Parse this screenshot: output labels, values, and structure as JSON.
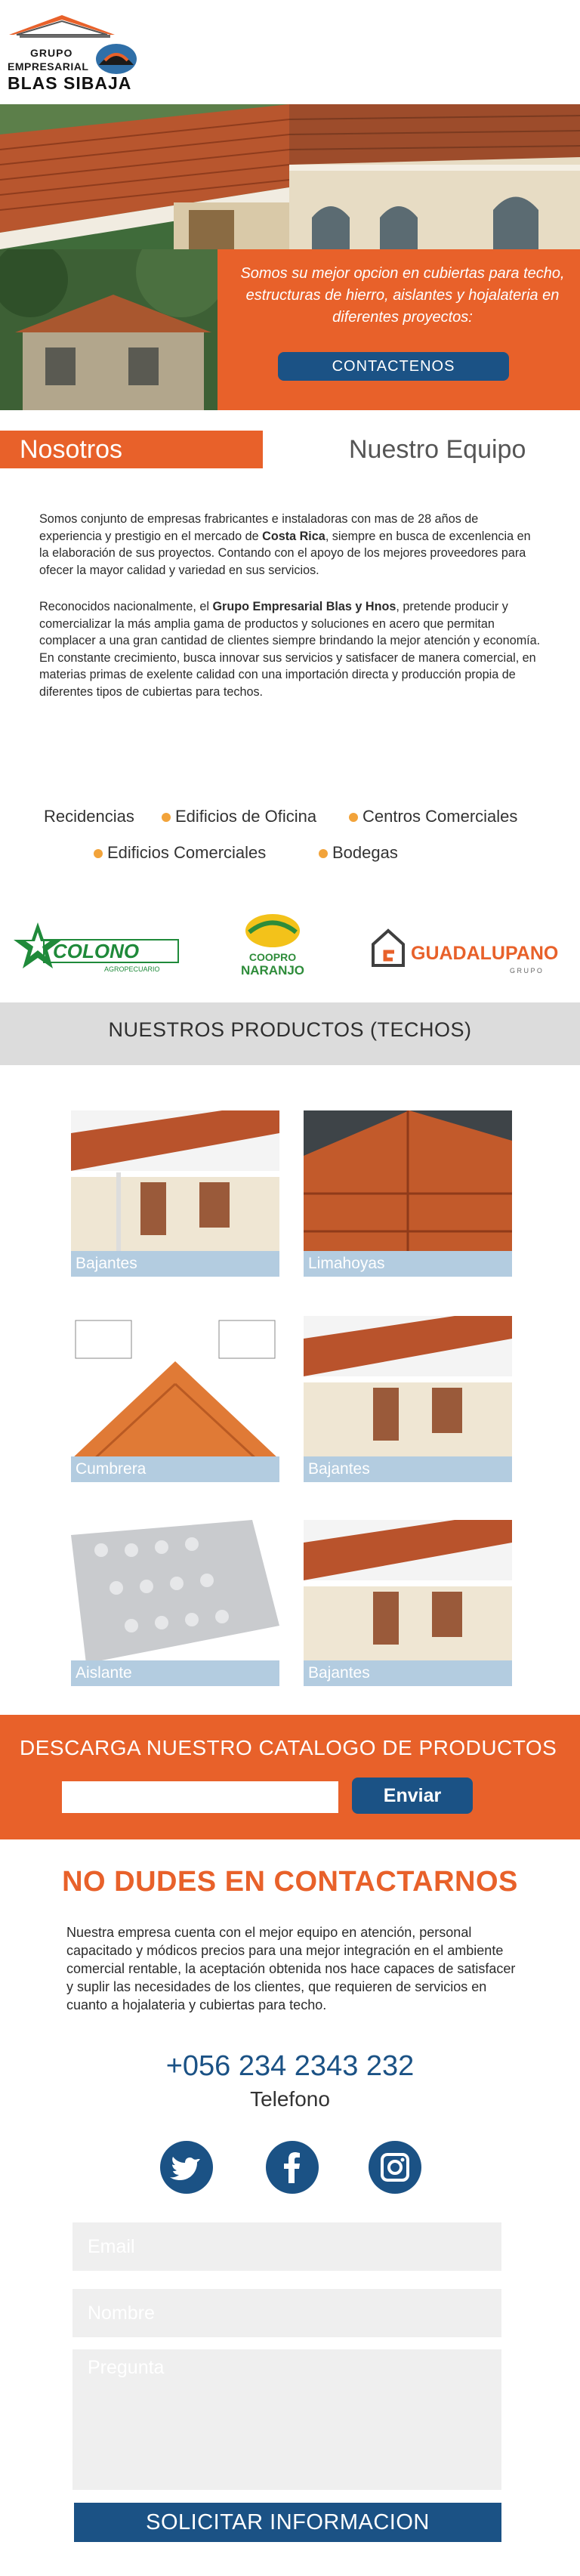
{
  "header": {
    "logo_line1": "GRUPO",
    "logo_line2": "EMPRESARIAL",
    "logo_line3": "BLAS SIBAJA"
  },
  "hero": {
    "text": "Somos su mejor opcion  en cubiertas para techo, estructuras de hierro, aislantes y hojalateria en diferentes proyectos:",
    "button": "CONTACTENOS"
  },
  "tabs": {
    "nosotros": "Nosotros",
    "equipo": "Nuestro Equipo"
  },
  "about": {
    "p1_a": "Somos conjunto de empresas frabricantes e instaladoras con mas de 28 años de experiencia  y prestigio en el mercado de ",
    "p1_b": "Costa Rica",
    "p1_c": ", siempre en busca de excenlencia en la elaboración de sus proyectos. Contando con el apoyo de los mejores proveedores para ofecer la mayor calidad y variedad en sus servicios.",
    "p2_a": "Reconocidos nacionalmente, el ",
    "p2_b": "Grupo Empresarial Blas y Hnos",
    "p2_c": ", pretende producir y comercializar la más amplia gama de productos y soluciones en acero que permitan complacer a una gran cantidad de clientes siempre brindando la mejor atención y economía. En constante crecimiento, busca innovar sus servicios y satisfacer de manera comercial, en materias primas de exelente calidad con una importación directa y producción propia de diferentes tipos de cubiertas para techos."
  },
  "categories": [
    "Recidencias",
    "Edificios de Oficina",
    "Centros Comerciales",
    "Edificios Comerciales",
    "Bodegas"
  ],
  "brands": {
    "colono": "COLONO",
    "colono_sub": "AGROPECUARIO",
    "coopro_1": "COOPRO",
    "coopro_2": "NARANJO",
    "guadalupano": "GUADALUPANO",
    "guadalupano_sub": "G R U P O"
  },
  "products": {
    "title": "NUESTROS PRODUCTOS (TECHOS)",
    "items": [
      "Bajantes",
      "Limahoyas",
      "Cumbrera",
      "Bajantes",
      "Aislante",
      "Bajantes"
    ]
  },
  "catalog": {
    "title": "DESCARGA NUESTRO CATALOGO DE PRODUCTOS",
    "button": "Enviar"
  },
  "contact": {
    "title": "NO DUDES EN CONTACTARNOS",
    "text": "Nuestra empresa cuenta con el mejor equipo en atención, personal capacitado y  módicos precios para una mejor integración en el ambiente comercial rentable, la aceptación obtenida nos hace capaces de satisfacer y suplir las necesidades de los clientes, que requieren de servicios en cuanto a hojalateria y cubiertas para techo.",
    "phone": "+056 234 2343 232",
    "phone_label": "Telefono",
    "email_placeholder": "Email",
    "name_placeholder": "Nombre",
    "question_placeholder": "Pregunta",
    "submit": "SOLICITAR INFORMACION"
  },
  "social": [
    "twitter-icon",
    "facebook-icon",
    "instagram-icon"
  ],
  "colors": {
    "accent": "#e8612a",
    "primary": "#1b5285",
    "label_bar": "#b3cce0",
    "bullet": "#f2a33a"
  }
}
